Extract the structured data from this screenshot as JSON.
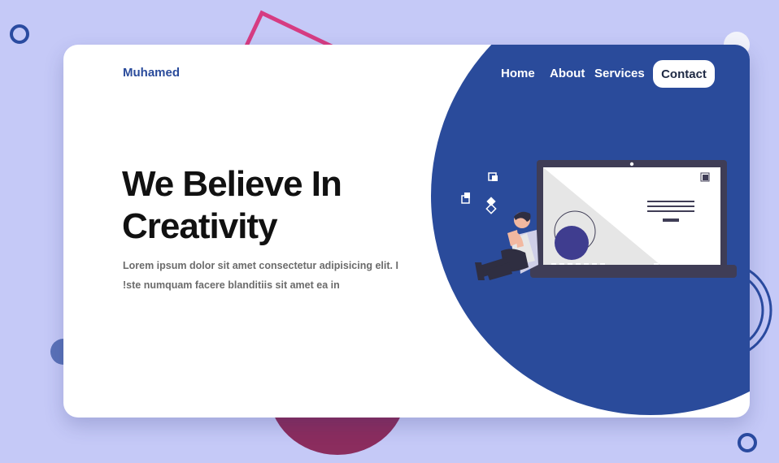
{
  "brand": "Muhamed",
  "nav": {
    "items": [
      "Home",
      "About",
      "Services"
    ],
    "cta": "Contact"
  },
  "hero": {
    "headline_line1": "We Believe In",
    "headline_line2": "Creativity",
    "lead_line1": "Lorem ipsum dolor sit amet consectetur adipisicing elit. I",
    "lead_line2": "!ste numquam facere blanditiis sit amet ea in"
  },
  "colors": {
    "background": "#c5c9f7",
    "card": "#ffffff",
    "accent_blue": "#2a4b9b",
    "accent_pink": "#d63c82",
    "accent_maroon": "#8b2d5e",
    "headline": "#111111",
    "body_text": "#6b6b6b"
  },
  "icons": [
    "laptop-illustration",
    "person-illustration",
    "floating-square-icons"
  ]
}
